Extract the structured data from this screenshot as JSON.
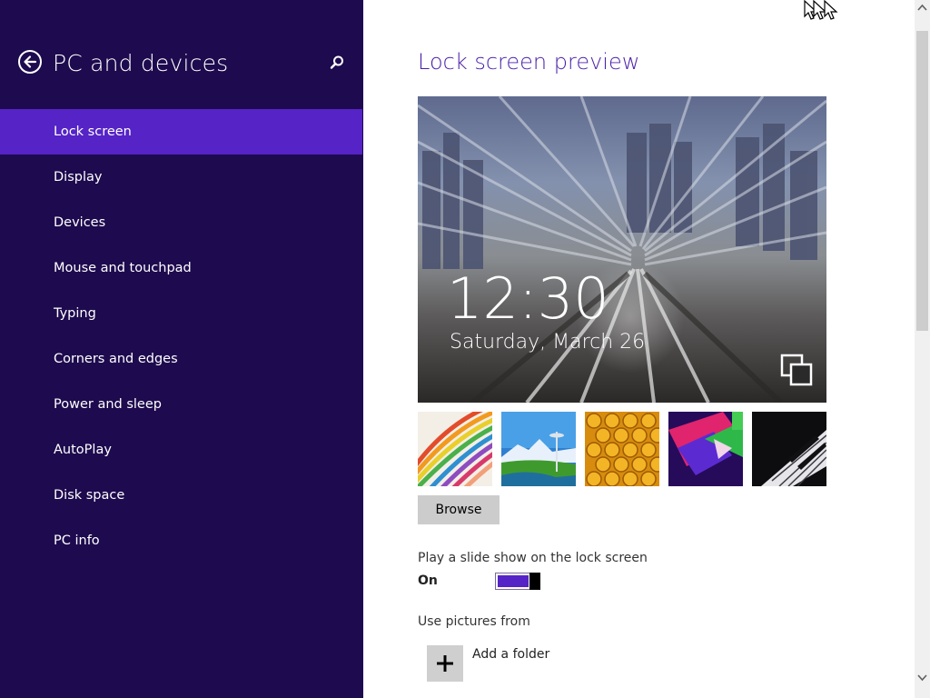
{
  "sidebar": {
    "title": "PC and devices",
    "back_icon": "back-arrow-icon",
    "search_icon": "search-icon",
    "items": [
      {
        "label": "Lock screen",
        "active": true
      },
      {
        "label": "Display"
      },
      {
        "label": "Devices"
      },
      {
        "label": "Mouse and touchpad"
      },
      {
        "label": "Typing"
      },
      {
        "label": "Corners and edges"
      },
      {
        "label": "Power and sleep"
      },
      {
        "label": "AutoPlay"
      },
      {
        "label": "Disk space"
      },
      {
        "label": "PC info"
      }
    ],
    "colors": {
      "background": "#1e0a4e",
      "active": "#5523c6"
    }
  },
  "main": {
    "heading": "Lock screen preview",
    "preview": {
      "time": "12:30",
      "date": "Saturday, March 26",
      "overlay_icon": "multitask-icon"
    },
    "thumbnails": [
      {
        "name": "rainbow-stripes"
      },
      {
        "name": "space-needle"
      },
      {
        "name": "honeycomb"
      },
      {
        "name": "abstract-shapes"
      },
      {
        "name": "piano-keys"
      }
    ],
    "browse_label": "Browse",
    "slideshow": {
      "label": "Play a slide show on the lock screen",
      "state_label": "On",
      "on": true
    },
    "pictures_from": {
      "label": "Use pictures from",
      "add_folder_label": "Add a folder",
      "add_icon": "plus-icon"
    },
    "accent_color": "#4a1fa8"
  },
  "scrollbar": {
    "up_icon": "scroll-up-arrow-icon",
    "down_icon": "scroll-down-arrow-icon"
  }
}
